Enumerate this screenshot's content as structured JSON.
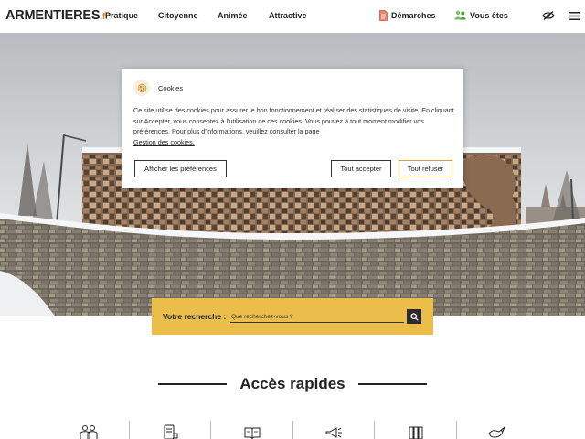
{
  "header": {
    "logo_main": "ARMENTIERES",
    "logo_tld": ".fr",
    "nav": [
      "Pratique",
      "Citoyenne",
      "Animée",
      "Attractive"
    ],
    "demarches_label": "Démarches",
    "vous_etes_label": "Vous êtes",
    "icons": [
      "document-icon",
      "people-icon",
      "eye-slash-icon",
      "menu-icon"
    ]
  },
  "search": {
    "label": "Votre recherche :",
    "placeholder": "Que recherchez-vous ?"
  },
  "quick_access": {
    "title": "Accès rapides",
    "icons": [
      "family-icon",
      "mobile-document-icon",
      "book-icon",
      "megaphone-icon",
      "library-icon",
      "bird-icon"
    ]
  },
  "cookie_dialog": {
    "title": "Cookies",
    "text": "Ce site utilise des cookies pour assurer le bon fonctionnement et réaliser des statistiques de visite. En cliquant sur Accepter, vous consentez à l'utilisation de ces cookies. Vous pouvez à tout moment modifier vos préférences. Pour plus d'informations, veuillez consulter la page",
    "link": "Gestion des cookies.",
    "btn_prefs": "Afficher les préférences",
    "btn_accept": "Tout accepter",
    "btn_refuse": "Tout refuser"
  },
  "colors": {
    "accent": "#ebbd4a",
    "logo_tld": "#d98a2b",
    "refuse_border": "#d9a03a",
    "dark": "#222222"
  }
}
